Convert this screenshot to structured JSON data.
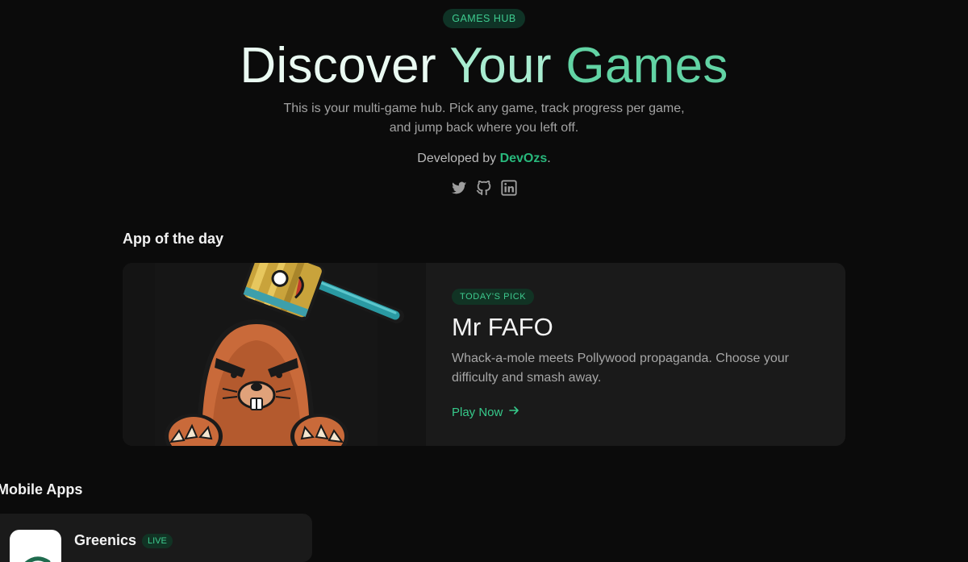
{
  "hero": {
    "badge": "GAMES HUB",
    "title_part1": "Discover ",
    "title_part2": "Your ",
    "title_part3": "Games",
    "subtitle": "This is your multi-game hub. Pick any game, track progress per game, and jump back where you left off.",
    "developed_by": "Developed by ",
    "developer": "DevOzs",
    "developer_suffix": "."
  },
  "socials": [
    "twitter-icon",
    "github-icon",
    "linkedin-icon"
  ],
  "app_of_day": {
    "section_title": "App of the day",
    "badge": "TODAY'S PICK",
    "title": "Mr FAFO",
    "description": "Whack-a-mole meets Pollywood propaganda. Choose your difficulty and smash away.",
    "cta": "Play Now",
    "cta_icon": "arrow-right-icon"
  },
  "mobile_apps": {
    "section_title": "Mobile Apps",
    "items": [
      {
        "name": "Greenics",
        "status": "LIVE"
      }
    ]
  },
  "colors": {
    "accent": "#28b87c",
    "background": "#0b0b0b",
    "card": "#1a1a1a"
  }
}
